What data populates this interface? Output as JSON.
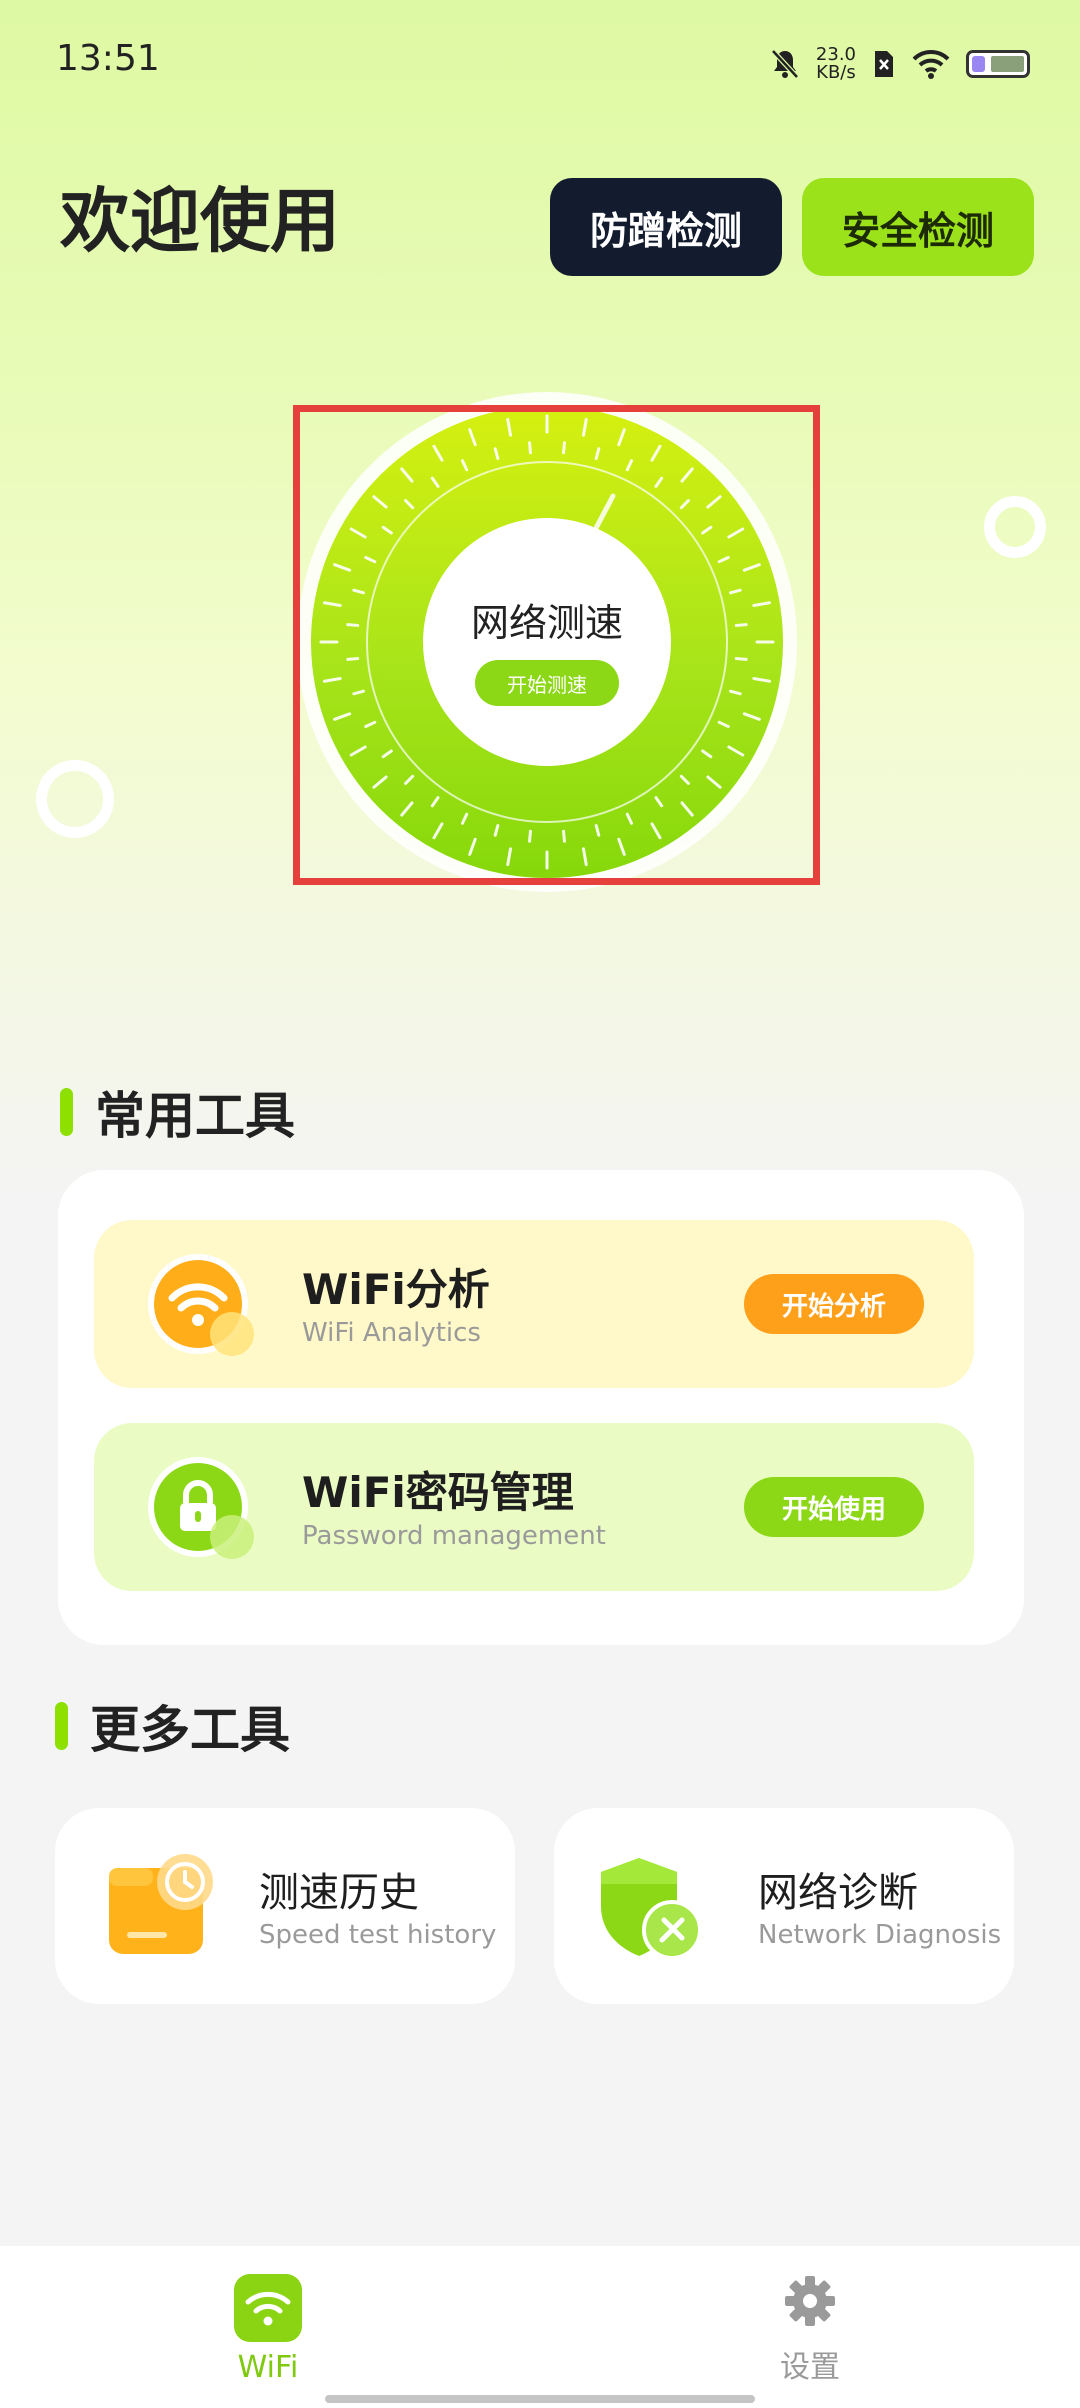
{
  "status_bar": {
    "time": "13:51",
    "net_speed_value": "23.0",
    "net_speed_unit": "KB/s",
    "icons": [
      "bell-off-icon",
      "sim-off-icon",
      "wifi-icon",
      "battery-icon"
    ],
    "battery_fill": 0.25
  },
  "header": {
    "title": "欢迎使用",
    "anti_button": "防蹭检测",
    "safe_button": "安全检测"
  },
  "speed_dial": {
    "title": "网络测速",
    "start_button": "开始测速"
  },
  "common_tools": {
    "section_title": "常用工具",
    "items": [
      {
        "title": "WiFi分析",
        "subtitle": "WiFi Analytics",
        "button": "开始分析",
        "icon": "wifi-icon",
        "color": "#ffa01a"
      },
      {
        "title": "WiFi密码管理",
        "subtitle": "Password management",
        "button": "开始使用",
        "icon": "lock-icon",
        "color": "#8cd816"
      }
    ]
  },
  "more_tools": {
    "section_title": "更多工具",
    "items": [
      {
        "title": "测速历史",
        "subtitle": "Speed test history",
        "icon": "history-icon"
      },
      {
        "title": "网络诊断",
        "subtitle": "Network Diagnosis",
        "icon": "shield-tools-icon"
      }
    ]
  },
  "bottom_nav": {
    "wifi_label": "WiFi",
    "settings_label": "设置"
  },
  "colors": {
    "accent": "#8ee000",
    "orange": "#ffa01a",
    "dark_button": "#121c2e",
    "highlight_box": "#e5403c"
  }
}
